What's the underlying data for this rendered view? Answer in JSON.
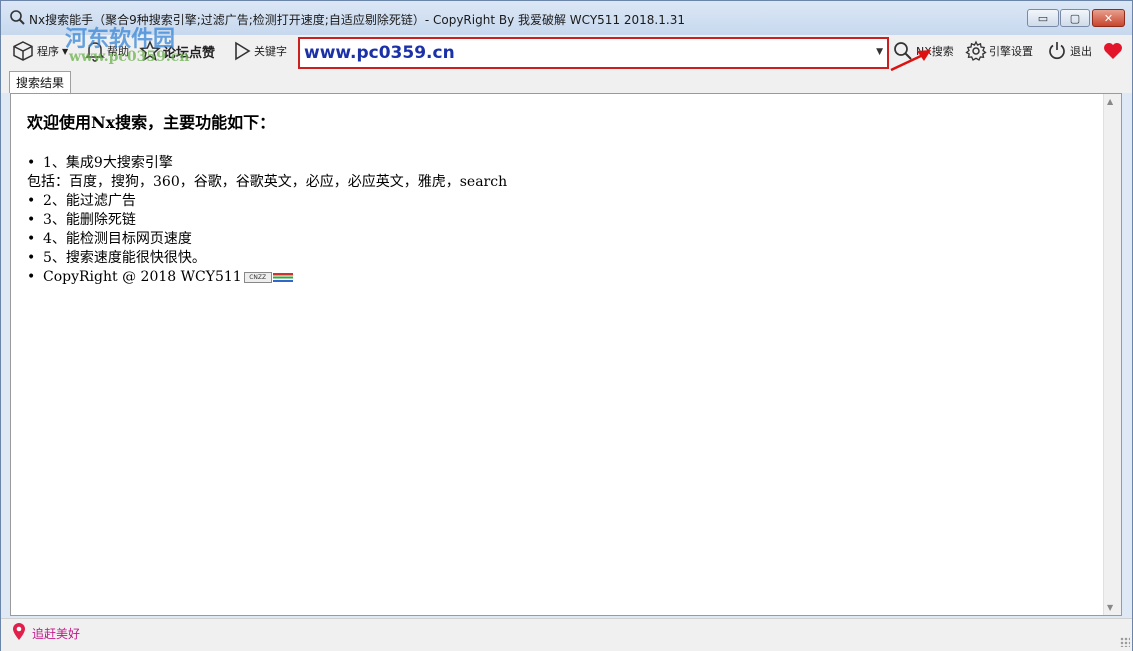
{
  "window": {
    "title": "Nx搜索能手（聚合9种搜索引擎;过滤广告;检测打开速度;自适应剔除死链）- CopyRight By 我爱破解 WCY511 2018.1.31",
    "min_label": "▭",
    "max_label": "▢",
    "close_label": "✕"
  },
  "toolbar": {
    "program_label": "程序",
    "help_label": "帮助",
    "forum_label": "论坛点赞",
    "keyword_label": "关键字",
    "search_value": "www.pc0359.cn",
    "search_label": "NX搜索",
    "engine_settings_label": "引擎设置",
    "exit_label": "退出"
  },
  "watermark": {
    "brand": "河东软件园",
    "url": "www.pc0359.cn"
  },
  "tabs": [
    {
      "label": "搜索结果"
    }
  ],
  "content": {
    "heading": "欢迎使用Nx搜索，主要功能如下：",
    "items": [
      "1、集成9大搜索引擎",
      "包括：百度，搜狗，360，谷歌，谷歌英文，必应，必应英文，雅虎，search",
      "2、能过滤广告",
      "3、能删除死链",
      "4、能检测目标网页速度",
      "5、搜索速度能很快很快。",
      "CopyRight @ 2018 WCY511"
    ],
    "badge": "CNZZ"
  },
  "statusbar": {
    "text": "追赶美好"
  },
  "colors": {
    "highlight_border": "#cc1f1f",
    "search_text": "#1b31a8",
    "status_text": "#c0178a",
    "heart": "#e3152a"
  }
}
